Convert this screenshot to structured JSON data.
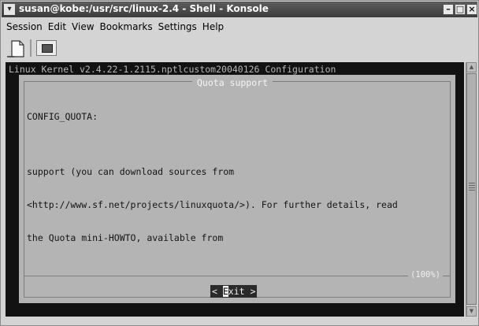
{
  "window": {
    "title": "susan@kobe:/usr/src/linux-2.4 - Shell - Konsole",
    "menu_icon": "chevron-down-icon",
    "minimize_glyph": "–",
    "maximize_glyph": "□",
    "close_glyph": "×"
  },
  "menubar": {
    "items": [
      {
        "label": "Session"
      },
      {
        "label": "Edit"
      },
      {
        "label": "View"
      },
      {
        "label": "Bookmarks"
      },
      {
        "label": "Settings"
      },
      {
        "label": "Help"
      }
    ]
  },
  "toolbar": {
    "icons": [
      "new-session-icon",
      "konsole-icon"
    ]
  },
  "terminal": {
    "header": "Linux Kernel v2.4.22-1.2115.nptlcustom20040126 Configuration",
    "dialog": {
      "title": "Quota support",
      "lines": [
        "CONFIG_QUOTA:",
        "",
        "support (you can download sources from",
        "<http://www.sf.net/projects/linuxquota/>). For further details, read",
        "the Quota mini-HOWTO, available from"
      ],
      "percent": "(100%)",
      "exit_button": {
        "left": "< ",
        "hotkey": "E",
        "rest": "xit >"
      }
    }
  },
  "colors": {
    "terminal_bg": "#121212",
    "dialog_bg": "#b4b4b4",
    "titlebar_bg": "#4a4a4a"
  }
}
